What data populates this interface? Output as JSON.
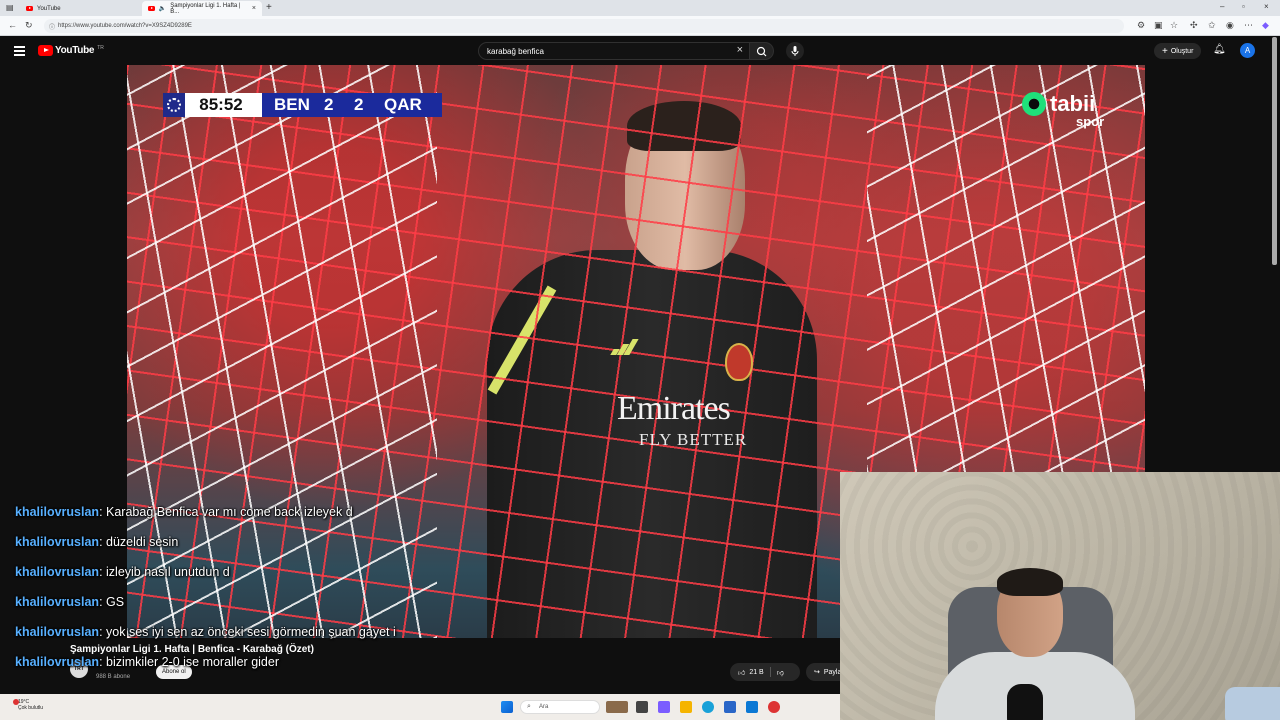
{
  "browser": {
    "tabs": [
      {
        "title": "YouTube"
      },
      {
        "title": "Şampiyonlar Ligi 1. Hafta | B..."
      }
    ],
    "url": "https://www.youtube.com/watch?v=X9SZ4D9289E"
  },
  "youtube": {
    "logo": "YouTube",
    "region": "TR",
    "search_value": "karabağ benfica",
    "create_label": "Oluştur",
    "avatar_letter": "A"
  },
  "video": {
    "scorebug": {
      "clock": "85:52",
      "home": "BEN",
      "home_score": "2",
      "away_score": "2",
      "away": "QAR"
    },
    "broadcaster": {
      "name": "tabii",
      "sub": "spor"
    },
    "shirt": {
      "sponsor": "Emirates",
      "tagline": "FLY BETTER"
    },
    "title": "Şampiyonlar Ligi 1. Hafta | Benfica - Karabağ (Özet)",
    "channel_avatar_text": "TRT",
    "subscribers": "988 B abone",
    "subscribe_label": "Abone ol",
    "likes": "21 B",
    "share_label": "Paylaş"
  },
  "chat": [
    {
      "user": "khalilovruslan",
      "text": "Karabağ Benfica var mı come back izleyek d"
    },
    {
      "user": "khalilovruslan",
      "text": "düzeldi sesin"
    },
    {
      "user": "khalilovruslan",
      "text": "izleyib nasıl unutdun d"
    },
    {
      "user": "khalilovruslan",
      "text": "GS"
    },
    {
      "user": "khalilovruslan",
      "text": "yok ses iyi sen az önceki sesi görmedin şuan gayet i"
    },
    {
      "user": "khalilovruslan",
      "text": "bizimkiler 2-0 ise moraller gider"
    }
  ],
  "taskbar": {
    "weather_temp": "19°C",
    "weather_desc": "Çok bulutlu",
    "search_placeholder": "Ara"
  }
}
